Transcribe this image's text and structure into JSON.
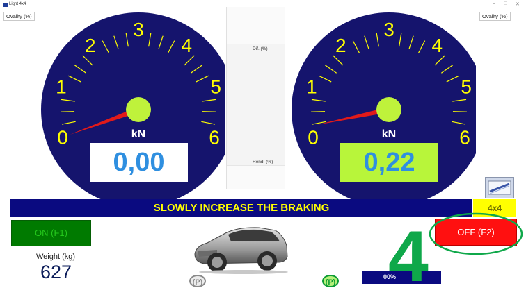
{
  "window": {
    "title": "Light 4x4",
    "controls": {
      "minimize": "–",
      "maximize": "□",
      "close": "✕"
    }
  },
  "labels": {
    "ovality_left": "Ovality (%)",
    "ovality_right": "Ovality (%)",
    "dif": "Dif. (%)",
    "rend": "Rend. (%)"
  },
  "gauges": [
    {
      "scale_labels": [
        "0",
        "1",
        "2",
        "3",
        "4",
        "5",
        "6"
      ],
      "unit": "kN",
      "value": 0.0,
      "display": "0,00",
      "display_bg": "#ffffff"
    },
    {
      "scale_labels": [
        "0",
        "1",
        "2",
        "3",
        "4",
        "5",
        "6"
      ],
      "unit": "kN",
      "value": 0.22,
      "display": "0,22",
      "display_bg": "#b8f53a"
    }
  ],
  "banner": {
    "text": "SLOWLY INCREASE THE BRAKING"
  },
  "mode_badge": "4x4",
  "buttons": {
    "on": "ON (F1)",
    "off": "OFF (F2)"
  },
  "weight": {
    "label": "Weight (kg)",
    "value": "627"
  },
  "parking_badges": [
    "(P)",
    "(P)"
  ],
  "percent_box": "00%",
  "annotation": {
    "number": "4"
  },
  "colors": {
    "gauge_bg": "#15146d",
    "gauge_text": "#ffff00",
    "needle": "#e11a1a",
    "hub": "#bff23b",
    "banner_bg": "#0a0a80",
    "banner_text": "#ffff00",
    "highlight": "#0fa84a"
  }
}
